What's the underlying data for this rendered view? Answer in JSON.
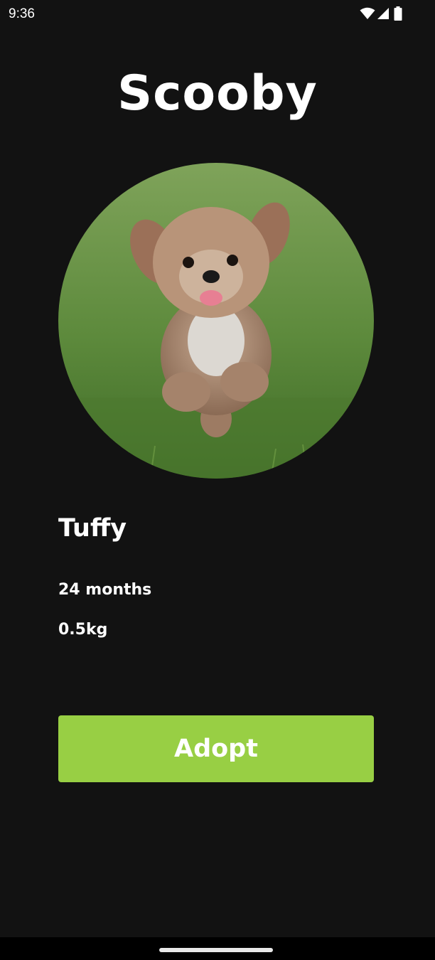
{
  "status_bar": {
    "time": "9:36",
    "icons": [
      "wifi-icon",
      "cellular-signal-icon",
      "battery-icon"
    ]
  },
  "header": {
    "title": "Scooby"
  },
  "pet": {
    "photo_icon": "dog-photo",
    "name": "Tuffy",
    "age": "24 months",
    "weight": "0.5kg"
  },
  "actions": {
    "adopt_label": "Adopt"
  },
  "colors": {
    "background": "#121212",
    "accent": "#98cf44",
    "text": "#ffffff"
  }
}
